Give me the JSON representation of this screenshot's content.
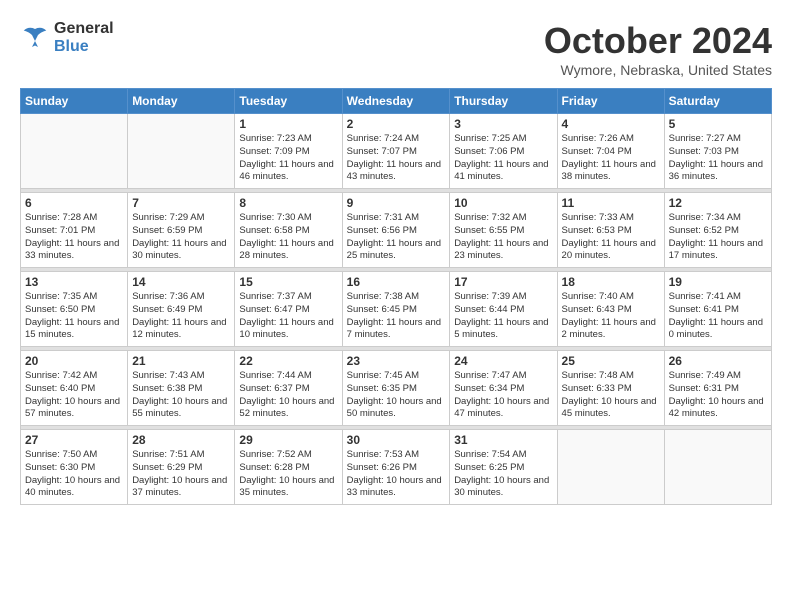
{
  "header": {
    "logo_general": "General",
    "logo_blue": "Blue",
    "month_title": "October 2024",
    "location": "Wymore, Nebraska, United States"
  },
  "days_of_week": [
    "Sunday",
    "Monday",
    "Tuesday",
    "Wednesday",
    "Thursday",
    "Friday",
    "Saturday"
  ],
  "weeks": [
    [
      {
        "day": "",
        "info": ""
      },
      {
        "day": "",
        "info": ""
      },
      {
        "day": "1",
        "info": "Sunrise: 7:23 AM\nSunset: 7:09 PM\nDaylight: 11 hours and 46 minutes."
      },
      {
        "day": "2",
        "info": "Sunrise: 7:24 AM\nSunset: 7:07 PM\nDaylight: 11 hours and 43 minutes."
      },
      {
        "day": "3",
        "info": "Sunrise: 7:25 AM\nSunset: 7:06 PM\nDaylight: 11 hours and 41 minutes."
      },
      {
        "day": "4",
        "info": "Sunrise: 7:26 AM\nSunset: 7:04 PM\nDaylight: 11 hours and 38 minutes."
      },
      {
        "day": "5",
        "info": "Sunrise: 7:27 AM\nSunset: 7:03 PM\nDaylight: 11 hours and 36 minutes."
      }
    ],
    [
      {
        "day": "6",
        "info": "Sunrise: 7:28 AM\nSunset: 7:01 PM\nDaylight: 11 hours and 33 minutes."
      },
      {
        "day": "7",
        "info": "Sunrise: 7:29 AM\nSunset: 6:59 PM\nDaylight: 11 hours and 30 minutes."
      },
      {
        "day": "8",
        "info": "Sunrise: 7:30 AM\nSunset: 6:58 PM\nDaylight: 11 hours and 28 minutes."
      },
      {
        "day": "9",
        "info": "Sunrise: 7:31 AM\nSunset: 6:56 PM\nDaylight: 11 hours and 25 minutes."
      },
      {
        "day": "10",
        "info": "Sunrise: 7:32 AM\nSunset: 6:55 PM\nDaylight: 11 hours and 23 minutes."
      },
      {
        "day": "11",
        "info": "Sunrise: 7:33 AM\nSunset: 6:53 PM\nDaylight: 11 hours and 20 minutes."
      },
      {
        "day": "12",
        "info": "Sunrise: 7:34 AM\nSunset: 6:52 PM\nDaylight: 11 hours and 17 minutes."
      }
    ],
    [
      {
        "day": "13",
        "info": "Sunrise: 7:35 AM\nSunset: 6:50 PM\nDaylight: 11 hours and 15 minutes."
      },
      {
        "day": "14",
        "info": "Sunrise: 7:36 AM\nSunset: 6:49 PM\nDaylight: 11 hours and 12 minutes."
      },
      {
        "day": "15",
        "info": "Sunrise: 7:37 AM\nSunset: 6:47 PM\nDaylight: 11 hours and 10 minutes."
      },
      {
        "day": "16",
        "info": "Sunrise: 7:38 AM\nSunset: 6:45 PM\nDaylight: 11 hours and 7 minutes."
      },
      {
        "day": "17",
        "info": "Sunrise: 7:39 AM\nSunset: 6:44 PM\nDaylight: 11 hours and 5 minutes."
      },
      {
        "day": "18",
        "info": "Sunrise: 7:40 AM\nSunset: 6:43 PM\nDaylight: 11 hours and 2 minutes."
      },
      {
        "day": "19",
        "info": "Sunrise: 7:41 AM\nSunset: 6:41 PM\nDaylight: 11 hours and 0 minutes."
      }
    ],
    [
      {
        "day": "20",
        "info": "Sunrise: 7:42 AM\nSunset: 6:40 PM\nDaylight: 10 hours and 57 minutes."
      },
      {
        "day": "21",
        "info": "Sunrise: 7:43 AM\nSunset: 6:38 PM\nDaylight: 10 hours and 55 minutes."
      },
      {
        "day": "22",
        "info": "Sunrise: 7:44 AM\nSunset: 6:37 PM\nDaylight: 10 hours and 52 minutes."
      },
      {
        "day": "23",
        "info": "Sunrise: 7:45 AM\nSunset: 6:35 PM\nDaylight: 10 hours and 50 minutes."
      },
      {
        "day": "24",
        "info": "Sunrise: 7:47 AM\nSunset: 6:34 PM\nDaylight: 10 hours and 47 minutes."
      },
      {
        "day": "25",
        "info": "Sunrise: 7:48 AM\nSunset: 6:33 PM\nDaylight: 10 hours and 45 minutes."
      },
      {
        "day": "26",
        "info": "Sunrise: 7:49 AM\nSunset: 6:31 PM\nDaylight: 10 hours and 42 minutes."
      }
    ],
    [
      {
        "day": "27",
        "info": "Sunrise: 7:50 AM\nSunset: 6:30 PM\nDaylight: 10 hours and 40 minutes."
      },
      {
        "day": "28",
        "info": "Sunrise: 7:51 AM\nSunset: 6:29 PM\nDaylight: 10 hours and 37 minutes."
      },
      {
        "day": "29",
        "info": "Sunrise: 7:52 AM\nSunset: 6:28 PM\nDaylight: 10 hours and 35 minutes."
      },
      {
        "day": "30",
        "info": "Sunrise: 7:53 AM\nSunset: 6:26 PM\nDaylight: 10 hours and 33 minutes."
      },
      {
        "day": "31",
        "info": "Sunrise: 7:54 AM\nSunset: 6:25 PM\nDaylight: 10 hours and 30 minutes."
      },
      {
        "day": "",
        "info": ""
      },
      {
        "day": "",
        "info": ""
      }
    ]
  ]
}
